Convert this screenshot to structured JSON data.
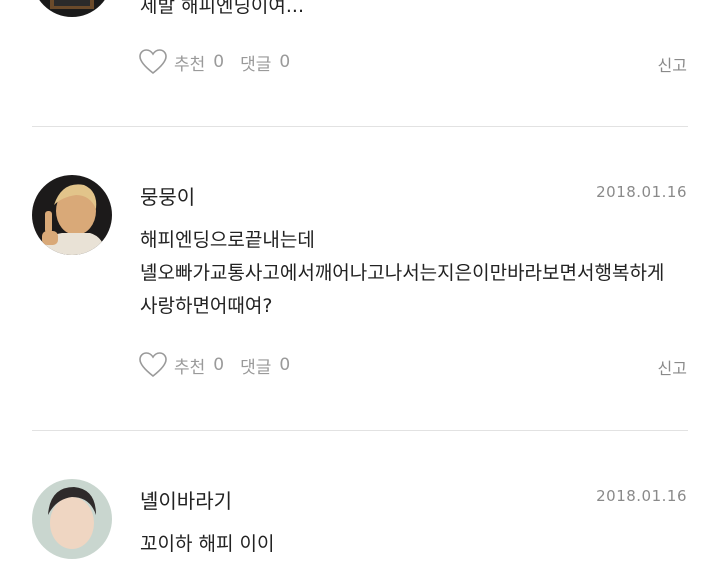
{
  "comments": [
    {
      "username": "",
      "date": "",
      "lines": [
        "제발 해피엔딩이여..."
      ],
      "like_label": "추천",
      "like_count": "0",
      "reply_label": "댓글",
      "reply_count": "0",
      "report_label": "신고"
    },
    {
      "username": "뭉뭉이",
      "date": "2018.01.16",
      "lines": [
        "해피엔딩으로끝내는데",
        "녤오빠가교통사고에서깨어나고나서는지은이만바라보면서행복하게",
        "사랑하면어때여?"
      ],
      "like_label": "추천",
      "like_count": "0",
      "reply_label": "댓글",
      "reply_count": "0",
      "report_label": "신고"
    },
    {
      "username": "녤이바라기",
      "date": "2018.01.16",
      "lines": [
        "꼬이하 해피 이이"
      ]
    }
  ],
  "colors": {
    "text": "#222222",
    "muted": "#9a9a9a",
    "divider": "#e2e2e2"
  },
  "icons": {
    "like": "heart-outline-icon"
  }
}
